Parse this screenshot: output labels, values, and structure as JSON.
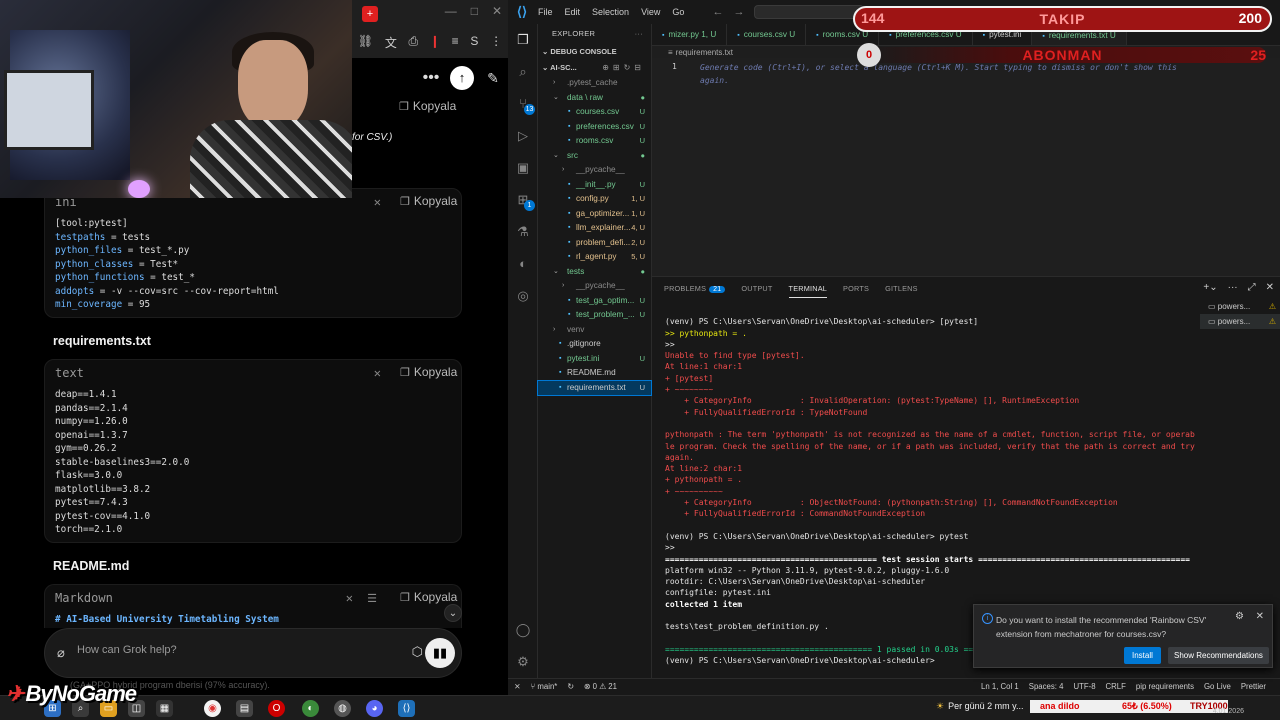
{
  "grok": {
    "kopyala": "Kopyala",
    "partial_text": "for CSV.)",
    "ini_block": {
      "lang": "ini",
      "lines": [
        {
          "k": "[tool:pytest]",
          "v": ""
        },
        {
          "k": "testpaths",
          "v": " = tests"
        },
        {
          "k": "python_files",
          "v": " = test_*.py"
        },
        {
          "k": "python_classes",
          "v": " = Test*"
        },
        {
          "k": "python_functions",
          "v": " = test_*"
        },
        {
          "k": "addopts",
          "v": " = -v --cov=src --cov-report=html"
        },
        {
          "k": "min_coverage",
          "v": " = 95"
        }
      ]
    },
    "req_title": "requirements.txt",
    "req_block": {
      "lang": "text",
      "lines": [
        "deap==1.4.1",
        "pandas==2.1.4",
        "numpy==1.26.0",
        "openai==1.3.7",
        "gym==0.26.2",
        "stable-baselines3==2.0.0",
        "flask==3.0.0",
        "matplotlib==3.8.2",
        "pytest==7.4.3",
        "pytest-cov==4.1.0",
        "torch==2.1.0"
      ]
    },
    "readme_title": "README.md",
    "md_block": {
      "lang": "Markdown",
      "first_line": "# AI-Based University Timetabling System"
    },
    "ask_placeholder": "How can Grok help?",
    "ghost_text": "(GA+PPO hybrid program dberisi (97% accuracy).",
    "brand": "ByNoGame"
  },
  "vscode": {
    "menu": [
      "File",
      "Edit",
      "Selection",
      "View",
      "Go"
    ],
    "explorer_title": "EXPLORER",
    "debug_console": "DEBUG CONSOLE",
    "project": "AI-SC...",
    "tree": [
      {
        "name": ".pytest_cache",
        "indent": 1,
        "type": "folder-collapsed",
        "color": "gray",
        "status": ""
      },
      {
        "name": "data \\ raw",
        "indent": 1,
        "type": "folder-open",
        "color": "green",
        "status": "●"
      },
      {
        "name": "courses.csv",
        "indent": 2,
        "type": "file",
        "color": "green",
        "status": "U"
      },
      {
        "name": "preferences.csv",
        "indent": 2,
        "type": "file",
        "color": "green",
        "status": "U"
      },
      {
        "name": "rooms.csv",
        "indent": 2,
        "type": "file",
        "color": "green",
        "status": "U"
      },
      {
        "name": "src",
        "indent": 1,
        "type": "folder-open",
        "color": "green",
        "status": "●"
      },
      {
        "name": "__pycache__",
        "indent": 2,
        "type": "folder-collapsed",
        "color": "gray",
        "status": ""
      },
      {
        "name": "__init__.py",
        "indent": 2,
        "type": "file",
        "color": "green",
        "status": "U"
      },
      {
        "name": "config.py",
        "indent": 2,
        "type": "file",
        "color": "yellow",
        "status": "1, U"
      },
      {
        "name": "ga_optimizer...",
        "indent": 2,
        "type": "file",
        "color": "yellow",
        "status": "1, U"
      },
      {
        "name": "llm_explainer...",
        "indent": 2,
        "type": "file",
        "color": "yellow",
        "status": "4, U"
      },
      {
        "name": "problem_defi...",
        "indent": 2,
        "type": "file",
        "color": "yellow",
        "status": "2, U"
      },
      {
        "name": "rl_agent.py",
        "indent": 2,
        "type": "file",
        "color": "yellow",
        "status": "5, U"
      },
      {
        "name": "tests",
        "indent": 1,
        "type": "folder-open",
        "color": "green",
        "status": "●"
      },
      {
        "name": "__pycache__",
        "indent": 2,
        "type": "folder-collapsed",
        "color": "gray",
        "status": ""
      },
      {
        "name": "test_ga_optim...",
        "indent": 2,
        "type": "file",
        "color": "green",
        "status": "U"
      },
      {
        "name": "test_problem_...",
        "indent": 2,
        "type": "file",
        "color": "green",
        "status": "U"
      },
      {
        "name": "venv",
        "indent": 1,
        "type": "folder-collapsed",
        "color": "gray",
        "status": ""
      },
      {
        "name": ".gitignore",
        "indent": 1,
        "type": "file",
        "color": "white",
        "status": ""
      },
      {
        "name": "pytest.ini",
        "indent": 1,
        "type": "file",
        "color": "green",
        "status": "U"
      },
      {
        "name": "README.md",
        "indent": 1,
        "type": "file",
        "color": "white",
        "status": ""
      },
      {
        "name": "requirements.txt",
        "indent": 1,
        "type": "file",
        "color": "white",
        "status": "U"
      }
    ],
    "tabs": [
      {
        "label": "mizer.py 1, U",
        "active": false
      },
      {
        "label": "courses.csv U",
        "active": false
      },
      {
        "label": "rooms.csv U",
        "active": false
      },
      {
        "label": "preferences.csv U",
        "active": false
      },
      {
        "label": "pytest.ini",
        "active": false
      },
      {
        "label": "requirements.txt U",
        "active": true
      }
    ],
    "breadcrumb": "requirements.txt",
    "editor_line": "1",
    "editor_hint": "Generate code (Ctrl+I), or select a language (Ctrl+K M). Start typing to dismiss or don't show this again.",
    "panel_tabs": {
      "problems": "PROBLEMS",
      "problems_count": "21",
      "output": "OUTPUT",
      "terminal": "TERMINAL",
      "ports": "PORTS",
      "gitlens": "GITLENS"
    },
    "terminal": [
      {
        "t": "",
        "c": "white"
      },
      {
        "t": "(venv) PS C:\\Users\\Servan\\OneDrive\\Desktop\\ai-scheduler> [pytest]",
        "c": "white",
        "dot": "blue"
      },
      {
        "t": ">> pythonpath = .",
        "c": "yellow"
      },
      {
        "t": ">>",
        "c": "white"
      },
      {
        "t": "Unable to find type [pytest].",
        "c": "red",
        "dot": "red"
      },
      {
        "t": "At line:1 char:1",
        "c": "red"
      },
      {
        "t": "+ [pytest]",
        "c": "red"
      },
      {
        "t": "+ ~~~~~~~~",
        "c": "red"
      },
      {
        "t": "    + CategoryInfo          : InvalidOperation: (pytest:TypeName) [], RuntimeException",
        "c": "red"
      },
      {
        "t": "    + FullyQualifiedErrorId : TypeNotFound",
        "c": "red"
      },
      {
        "t": "",
        "c": "white"
      },
      {
        "t": "pythonpath : The term 'pythonpath' is not recognized as the name of a cmdlet, function, script file, or operable program. Check the spelling of the name, or if a path was included, verify that the path is correct and try again.",
        "c": "red"
      },
      {
        "t": "At line:2 char:1",
        "c": "red"
      },
      {
        "t": "+ pythonpath = .",
        "c": "red"
      },
      {
        "t": "+ ~~~~~~~~~~",
        "c": "red"
      },
      {
        "t": "    + CategoryInfo          : ObjectNotFound: (pythonpath:String) [], CommandNotFoundException",
        "c": "red"
      },
      {
        "t": "    + FullyQualifiedErrorId : CommandNotFoundException",
        "c": "red"
      },
      {
        "t": "",
        "c": "white"
      },
      {
        "t": "(venv) PS C:\\Users\\Servan\\OneDrive\\Desktop\\ai-scheduler> pytest",
        "c": "white",
        "dot": "blue"
      },
      {
        "t": ">>",
        "c": "white"
      },
      {
        "t": "============================================ test session starts ============================================",
        "c": "bold"
      },
      {
        "t": "platform win32 -- Python 3.11.9, pytest-9.0.2, pluggy-1.6.0",
        "c": "white"
      },
      {
        "t": "rootdir: C:\\Users\\Servan\\OneDrive\\Desktop\\ai-scheduler",
        "c": "white"
      },
      {
        "t": "configfile: pytest.ini",
        "c": "white"
      },
      {
        "t": "collected 1 item",
        "c": "bold"
      },
      {
        "t": "",
        "c": "white"
      },
      {
        "t": "tests\\test_problem_definition.py .",
        "c": "white"
      },
      {
        "t": "",
        "c": "white"
      },
      {
        "t": "=========================================== 1 passed in 0.03s ===========================================",
        "c": "green"
      },
      {
        "t": "(venv) PS C:\\Users\\Servan\\OneDrive\\Desktop\\ai-scheduler> ",
        "c": "white",
        "dot": "blue"
      }
    ],
    "terminal_list": [
      "powers...",
      "powers..."
    ],
    "notification": {
      "message": "Do you want to install the recommended 'Rainbow CSV' extension from mechatroner for courses.csv?",
      "install": "Install",
      "show": "Show Recommendations"
    },
    "status_left": [
      "main*",
      "⊗ 0 ⚠ 21"
    ],
    "status_right": [
      "Ln 1, Col 1",
      "Spaces: 4",
      "UTF-8",
      "CRLF",
      "pip requirements",
      "Go Live",
      "Prettier"
    ]
  },
  "overlays": {
    "takip_left": "144",
    "takip_label": "TAKIP",
    "takip_right": "200",
    "abon_left": "0",
    "abon_label": "ABONMAN",
    "abon_right": "25"
  },
  "taskbar": {
    "weather": "Per günü 2 mm y...",
    "ticker_a": "ana dildo",
    "ticker_b": "65₺ (6.50%)",
    "ticker_c": "TRY1000",
    "date": "4.01.2026"
  }
}
